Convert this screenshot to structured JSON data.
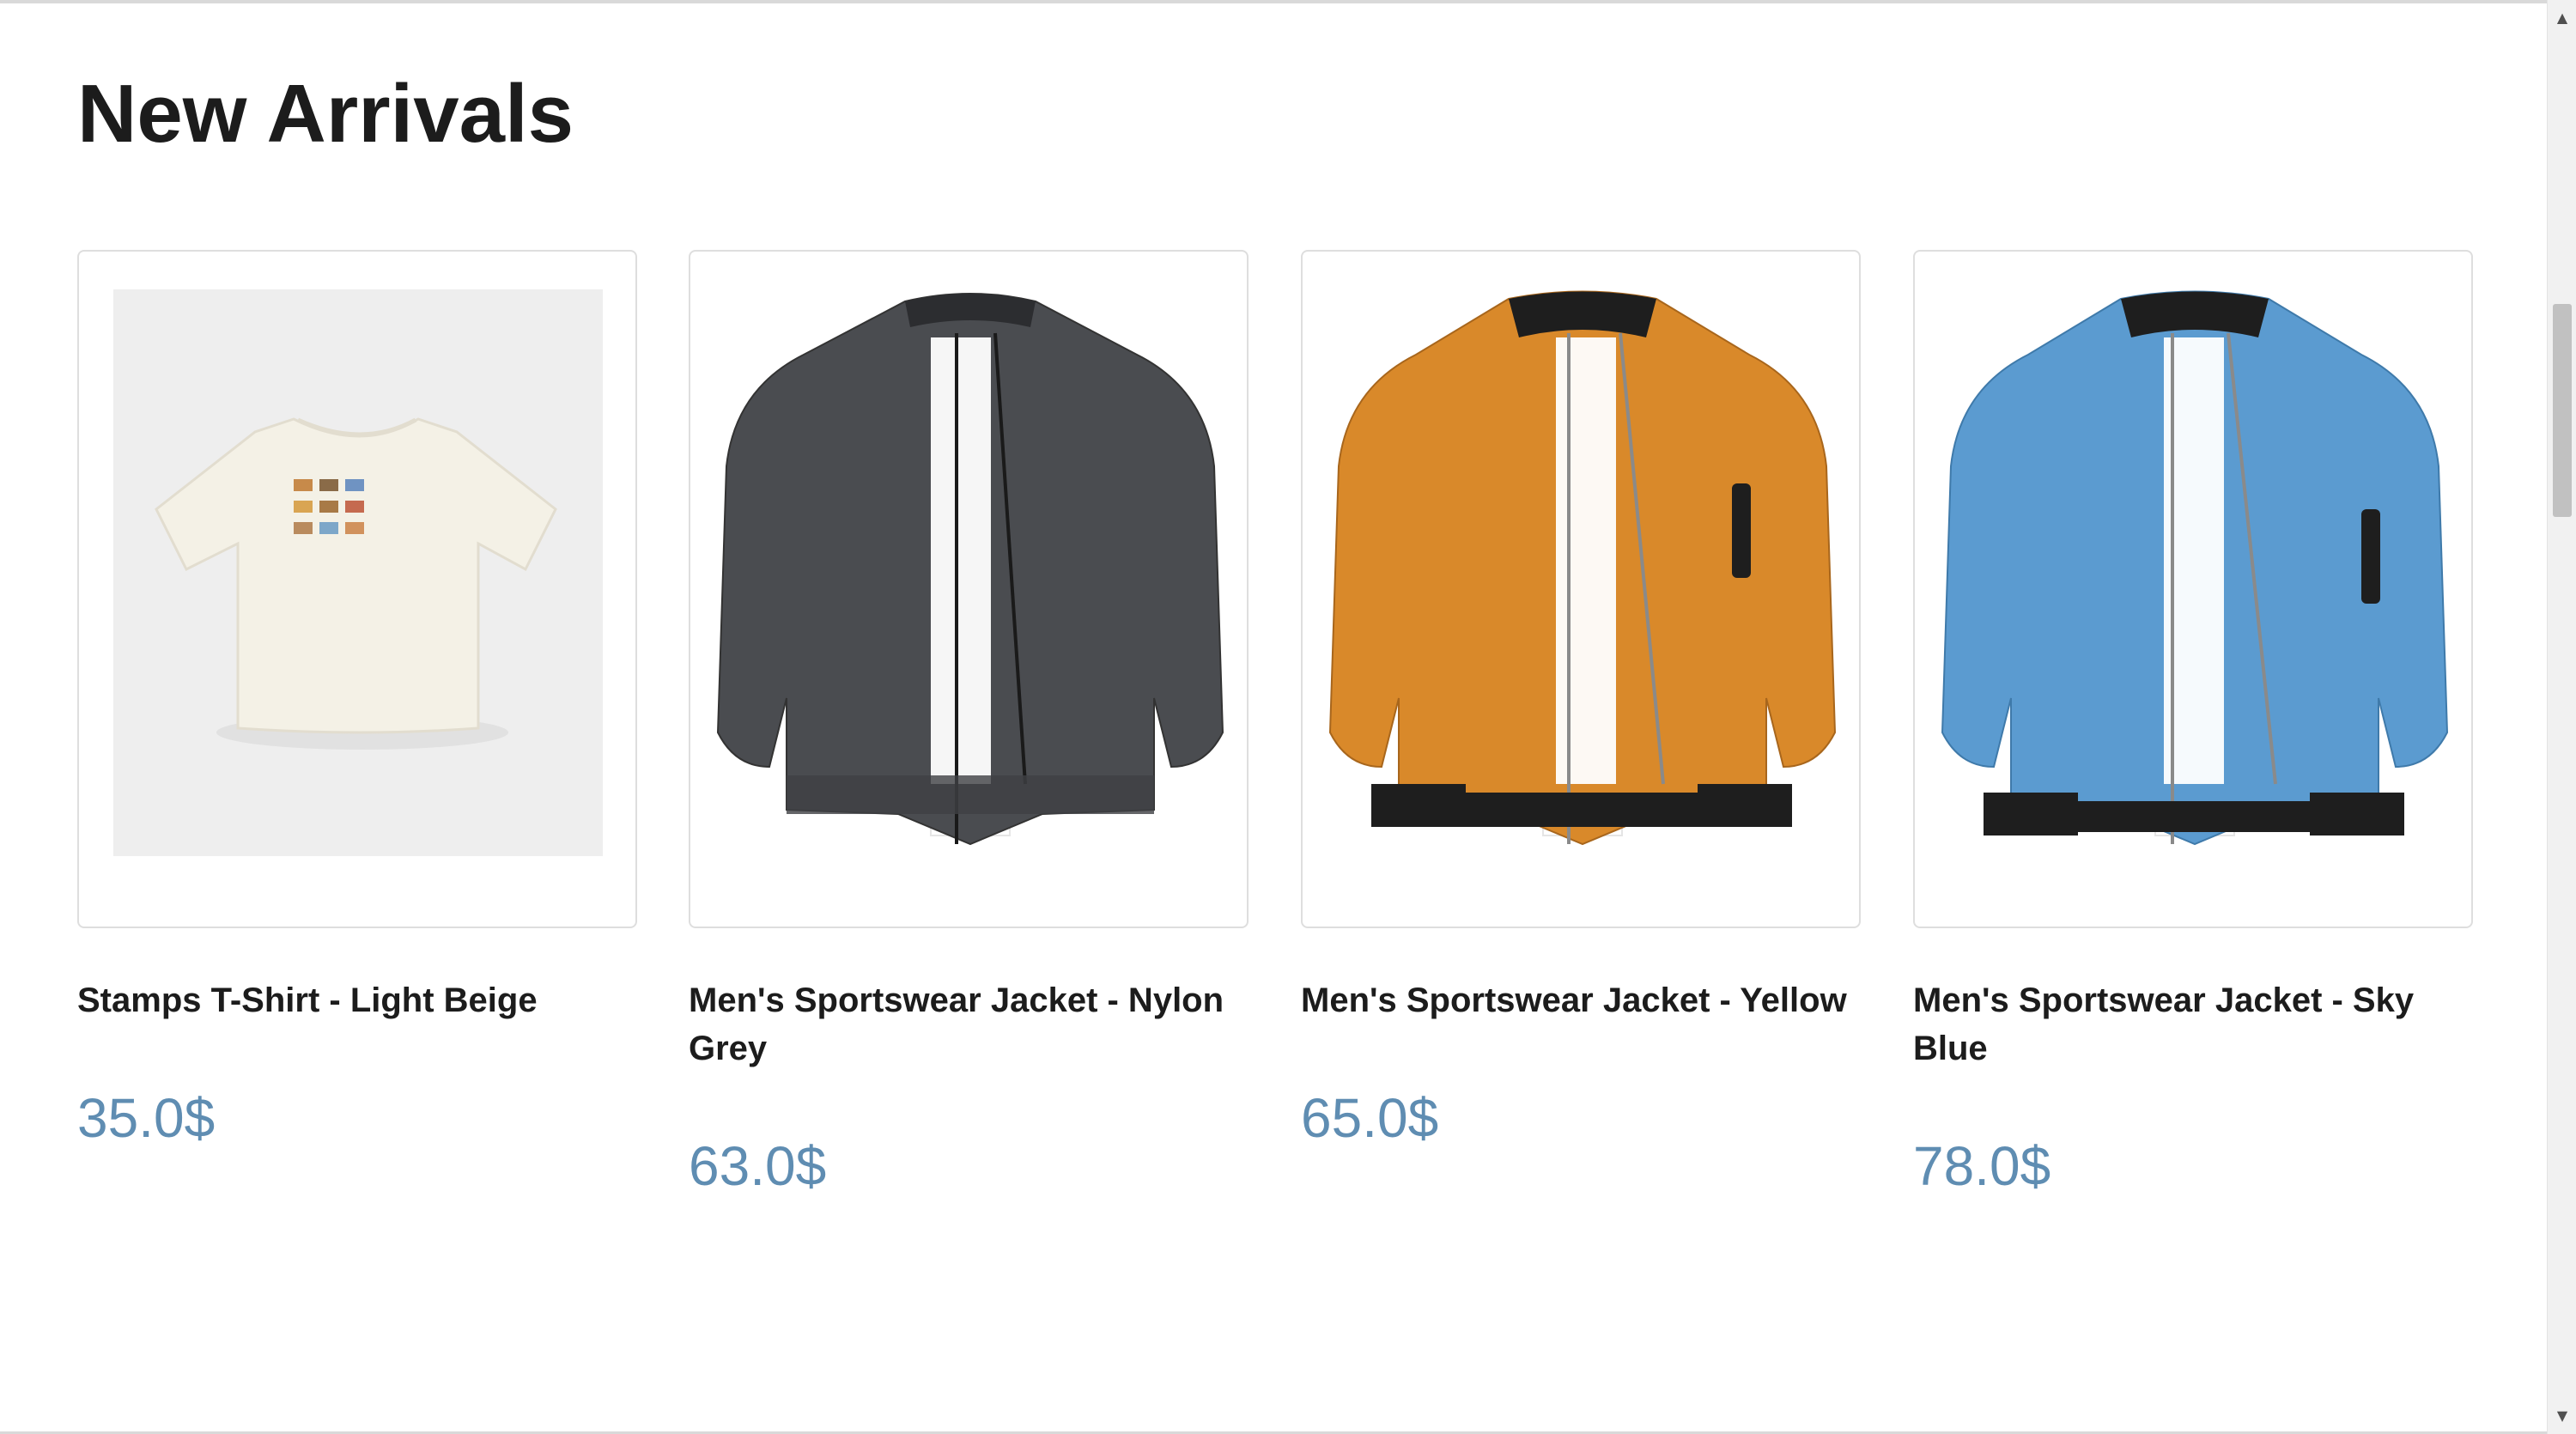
{
  "section": {
    "title": "New Arrivals"
  },
  "products": [
    {
      "name": "Stamps T-Shirt - Light Beige",
      "price": "35.0$",
      "color": "#f3efe4",
      "kind": "tshirt"
    },
    {
      "name": "Men's Sportswear Jacket - Nylon Grey",
      "price": "63.0$",
      "color": "#4a4c50",
      "kind": "jacket"
    },
    {
      "name": "Men's Sportswear Jacket - Yellow",
      "price": "65.0$",
      "color": "#d9892a",
      "kind": "jacket"
    },
    {
      "name": "Men's Sportswear Jacket - Sky Blue",
      "price": "78.0$",
      "color": "#5b9bd0",
      "kind": "jacket"
    }
  ],
  "theme": {
    "price_color": "#5f8db2",
    "border_color": "#dedede"
  },
  "scrollbar": {
    "up_icon": "arrow-up-icon",
    "down_icon": "arrow-down-icon"
  }
}
